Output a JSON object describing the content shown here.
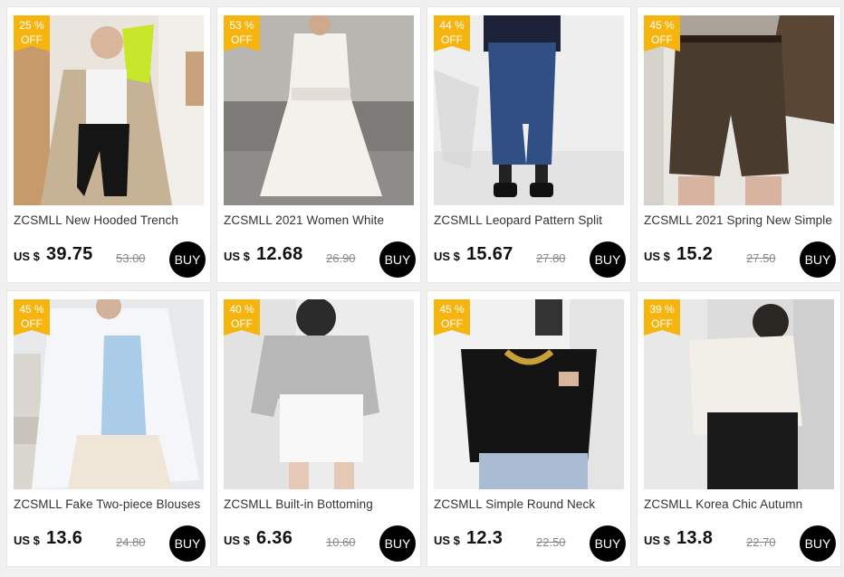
{
  "products": [
    {
      "badge_pct": "25 %",
      "badge_off": "OFF",
      "title": "ZCSMLL New Hooded Trench",
      "currency": "US $",
      "price": "39.75",
      "original": "53.00",
      "buy": "BUY",
      "theme": "trench"
    },
    {
      "badge_pct": "53 %",
      "badge_off": "OFF",
      "title": "ZCSMLL 2021 Women White",
      "currency": "US $",
      "price": "12.68",
      "original": "26.90",
      "buy": "BUY",
      "theme": "white-dress"
    },
    {
      "badge_pct": "44 %",
      "badge_off": "OFF",
      "title": "ZCSMLL Leopard Pattern Split",
      "currency": "US $",
      "price": "15.67",
      "original": "27.80",
      "buy": "BUY",
      "theme": "skirt"
    },
    {
      "badge_pct": "45 %",
      "badge_off": "OFF",
      "title": "ZCSMLL 2021 Spring New Simple",
      "currency": "US $",
      "price": "15.2",
      "original": "27.50",
      "buy": "BUY",
      "theme": "shorts"
    },
    {
      "badge_pct": "45 %",
      "badge_off": "OFF",
      "title": "ZCSMLL Fake Two-piece Blouses",
      "currency": "US $",
      "price": "13.6",
      "original": "24.80",
      "buy": "BUY",
      "theme": "blouse"
    },
    {
      "badge_pct": "40 %",
      "badge_off": "OFF",
      "title": "ZCSMLL Built-in Bottoming",
      "currency": "US $",
      "price": "6.36",
      "original": "10.60",
      "buy": "BUY",
      "theme": "hoodie"
    },
    {
      "badge_pct": "45 %",
      "badge_off": "OFF",
      "title": "ZCSMLL Simple Round Neck",
      "currency": "US $",
      "price": "12.3",
      "original": "22.50",
      "buy": "BUY",
      "theme": "tee"
    },
    {
      "badge_pct": "39 %",
      "badge_off": "OFF",
      "title": "ZCSMLL Korea Chic Autumn",
      "currency": "US $",
      "price": "13.8",
      "original": "22.70",
      "buy": "BUY",
      "theme": "offshoulder"
    }
  ],
  "colors": {
    "badge": "#f6b40e",
    "buy_button": "#000000",
    "page_bg": "#f0f0f0"
  }
}
